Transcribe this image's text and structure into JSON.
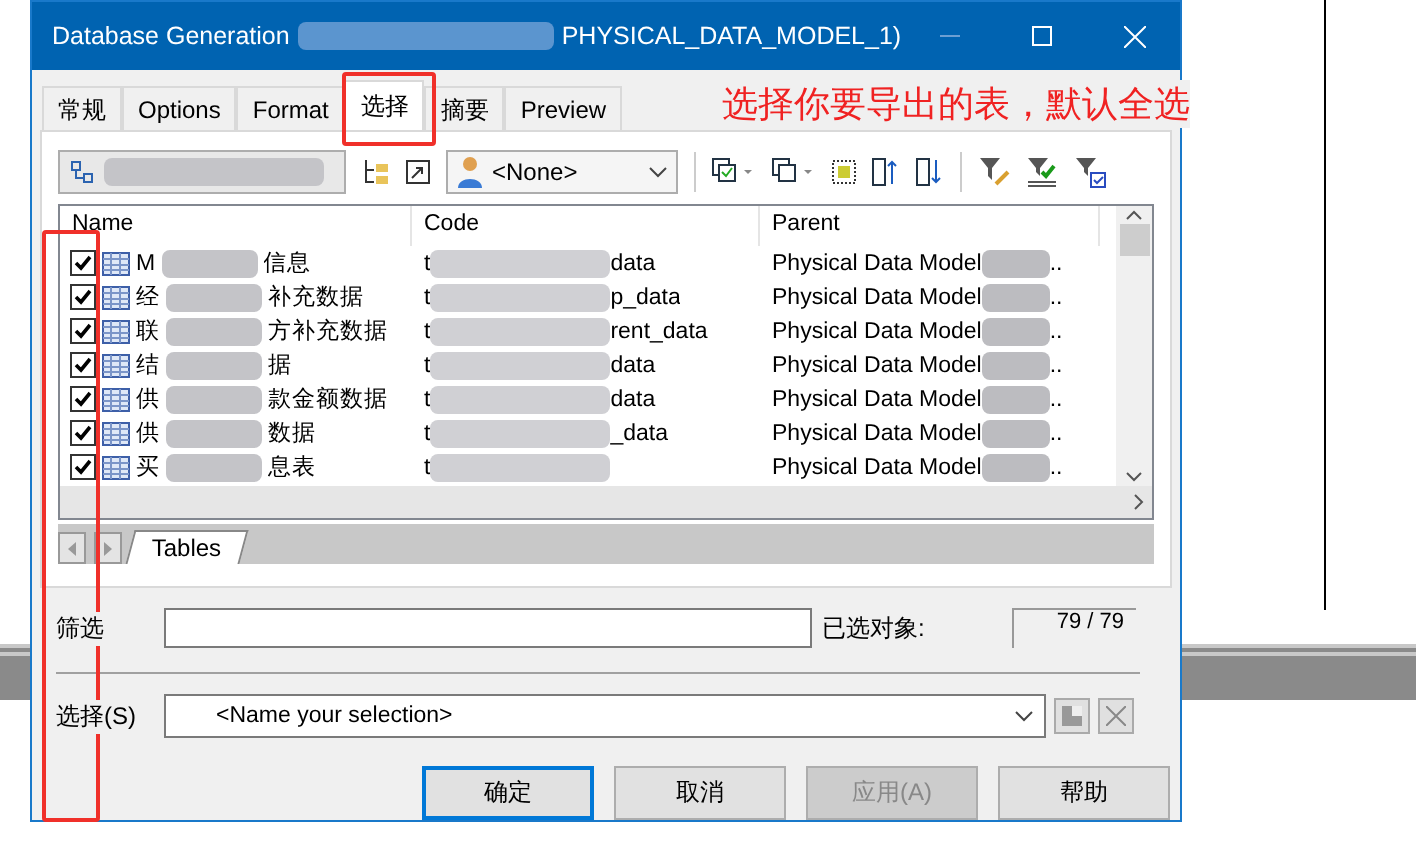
{
  "window": {
    "title_start": "Database Generation",
    "title_end": "PHYSICAL_DATA_MODEL_1)"
  },
  "tabs": [
    {
      "label": "常规",
      "selected": false
    },
    {
      "label": "Options",
      "selected": false
    },
    {
      "label": "Format",
      "selected": false
    },
    {
      "label": "选择",
      "selected": true
    },
    {
      "label": "摘要",
      "selected": false
    },
    {
      "label": "Preview",
      "selected": false
    }
  ],
  "annotation": {
    "text": "选择你要导出的表，默认全选"
  },
  "owner_dropdown": {
    "value": "<None>"
  },
  "table": {
    "columns": [
      "Name",
      "Code",
      "Parent"
    ],
    "rows": [
      {
        "checked": true,
        "name_start": "M",
        "name_end": "信息",
        "code_start": "t",
        "code_end": "data",
        "parent": "Physical Data Model",
        "parent_end": ".."
      },
      {
        "checked": true,
        "name_start": "经",
        "name_end": "补充数据",
        "code_start": "t",
        "code_end": "p_data",
        "parent": "Physical Data Model",
        "parent_end": ".."
      },
      {
        "checked": true,
        "name_start": "联",
        "name_end": "方补充数据",
        "code_start": "t",
        "code_end": "rent_data",
        "parent": "Physical Data Model",
        "parent_end": ".."
      },
      {
        "checked": true,
        "name_start": "结",
        "name_end": "据",
        "code_start": "t",
        "code_end": "data",
        "parent": "Physical Data Model",
        "parent_end": ".."
      },
      {
        "checked": true,
        "name_start": "供",
        "name_end": "款金额数据",
        "code_start": "t",
        "code_end": "data",
        "parent": "Physical Data Model",
        "parent_end": ".."
      },
      {
        "checked": true,
        "name_start": "供",
        "name_end": "数据",
        "code_start": "t",
        "code_end": "_data",
        "parent": "Physical Data Model",
        "parent_end": ".."
      },
      {
        "checked": true,
        "name_start": "买",
        "name_end": "息表",
        "code_start": "t",
        "code_end": "",
        "parent": "Physical Data Model",
        "parent_end": ".."
      }
    ]
  },
  "sheet_tab": "Tables",
  "filter": {
    "label": "筛选",
    "count_label": "已选对象:",
    "count": "79 / 79"
  },
  "selection": {
    "label": "选择(S)",
    "value": "<Name your selection>"
  },
  "buttons": [
    {
      "label": "确定",
      "kind": "default"
    },
    {
      "label": "取消",
      "kind": "normal"
    },
    {
      "label": "应用(A)",
      "kind": "disabled"
    },
    {
      "label": "帮助",
      "kind": "normal"
    }
  ]
}
